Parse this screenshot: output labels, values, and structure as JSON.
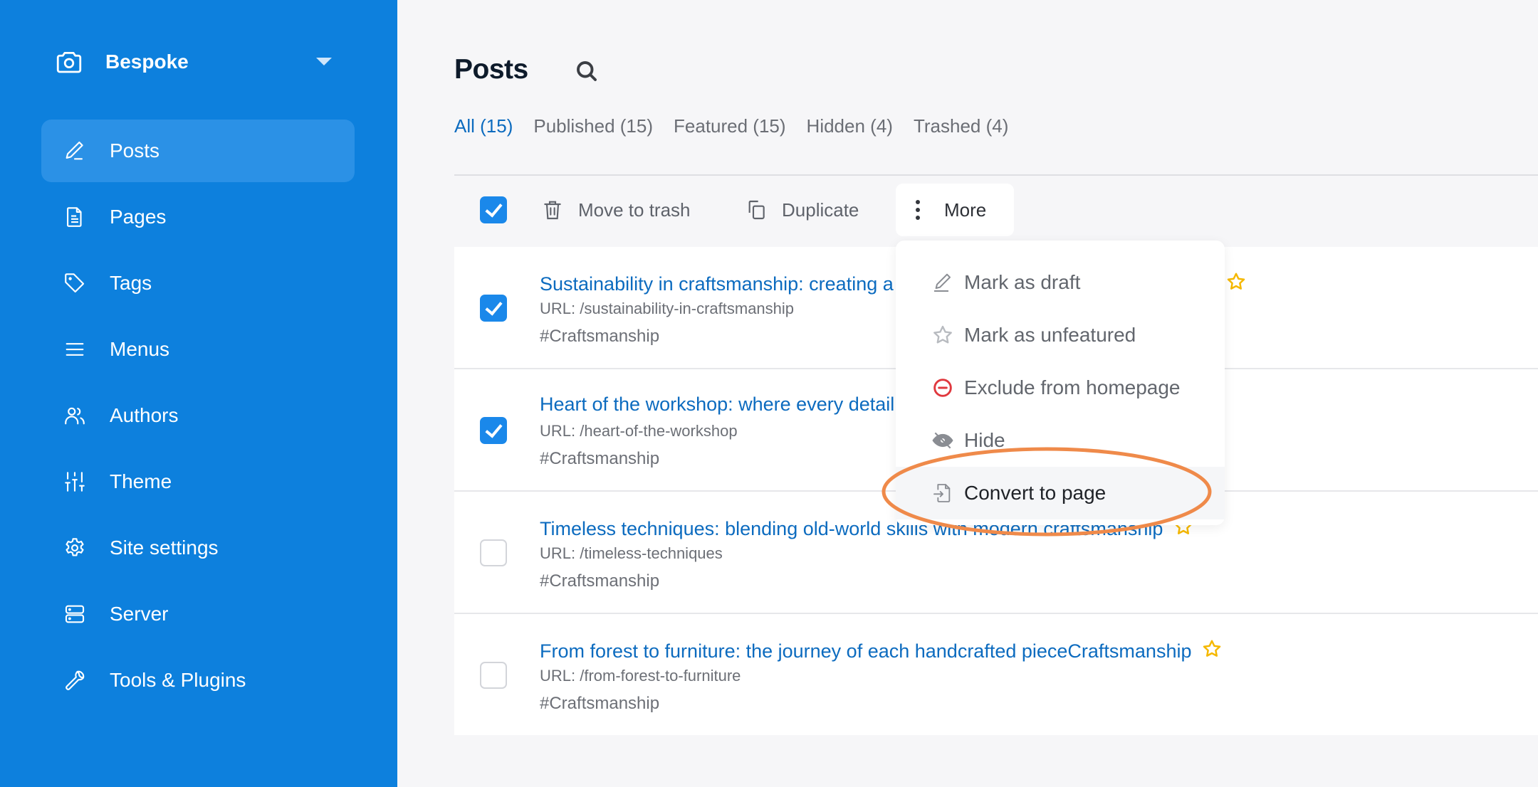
{
  "sidebar": {
    "site_name": "Bespoke",
    "site_icon": "camera-icon",
    "items": [
      {
        "label": "Posts",
        "icon": "pencil-icon",
        "active": true
      },
      {
        "label": "Pages",
        "icon": "document-icon"
      },
      {
        "label": "Tags",
        "icon": "tag-icon"
      },
      {
        "label": "Menus",
        "icon": "menu-lines-icon"
      },
      {
        "label": "Authors",
        "icon": "users-icon"
      },
      {
        "label": "Theme",
        "icon": "sliders-icon"
      },
      {
        "label": "Site settings",
        "icon": "gear-icon"
      },
      {
        "label": "Server",
        "icon": "server-icon"
      },
      {
        "label": "Tools & Plugins",
        "icon": "wrench-icon"
      }
    ]
  },
  "header": {
    "title": "Posts",
    "search_icon": "search-icon"
  },
  "tabs": [
    {
      "label": "All (15)",
      "active": true
    },
    {
      "label": "Published (15)"
    },
    {
      "label": "Featured (15)"
    },
    {
      "label": "Hidden (4)"
    },
    {
      "label": "Trashed (4)"
    }
  ],
  "toolbar": {
    "select_all_checked": true,
    "trash_label": "Move to trash",
    "duplicate_label": "Duplicate",
    "more_label": "More"
  },
  "posts": [
    {
      "title": "Sustainability in craftsmanship: creating a greener future through craftsmanship",
      "url": "URL: /sustainability-in-craftsmanship",
      "tag": "#Craftsmanship",
      "checked": true,
      "featured": true
    },
    {
      "title": "Heart of the workshop: where every detail tells a story",
      "url": "URL: /heart-of-the-workshop",
      "tag": "#Craftsmanship",
      "checked": true,
      "featured": false
    },
    {
      "title": "Timeless techniques: blending old-world skills with modern craftsmanship",
      "url": "URL: /timeless-techniques",
      "tag": "#Craftsmanship",
      "checked": false,
      "featured": true
    },
    {
      "title": "From forest to furniture: the journey of each handcrafted pieceCraftsmanship",
      "url": "URL: /from-forest-to-furniture",
      "tag": "#Craftsmanship",
      "checked": false,
      "featured": true
    }
  ],
  "more_menu": {
    "items": [
      {
        "label": "Mark as draft",
        "icon": "pencil-icon"
      },
      {
        "label": "Mark as unfeatured",
        "icon": "star-outline-icon"
      },
      {
        "label": "Exclude from homepage",
        "icon": "minus-circle-icon"
      },
      {
        "label": "Hide",
        "icon": "eye-slash-icon"
      },
      {
        "label": "Convert to page",
        "icon": "file-import-icon",
        "highlighted": true
      }
    ]
  },
  "colors": {
    "sidebar": "#0d80dd",
    "accent": "#0c6bbf",
    "checkbox": "#1a88ea",
    "star": "#f5b800",
    "danger": "#e0383e",
    "annotation": "#ef8a4a"
  }
}
